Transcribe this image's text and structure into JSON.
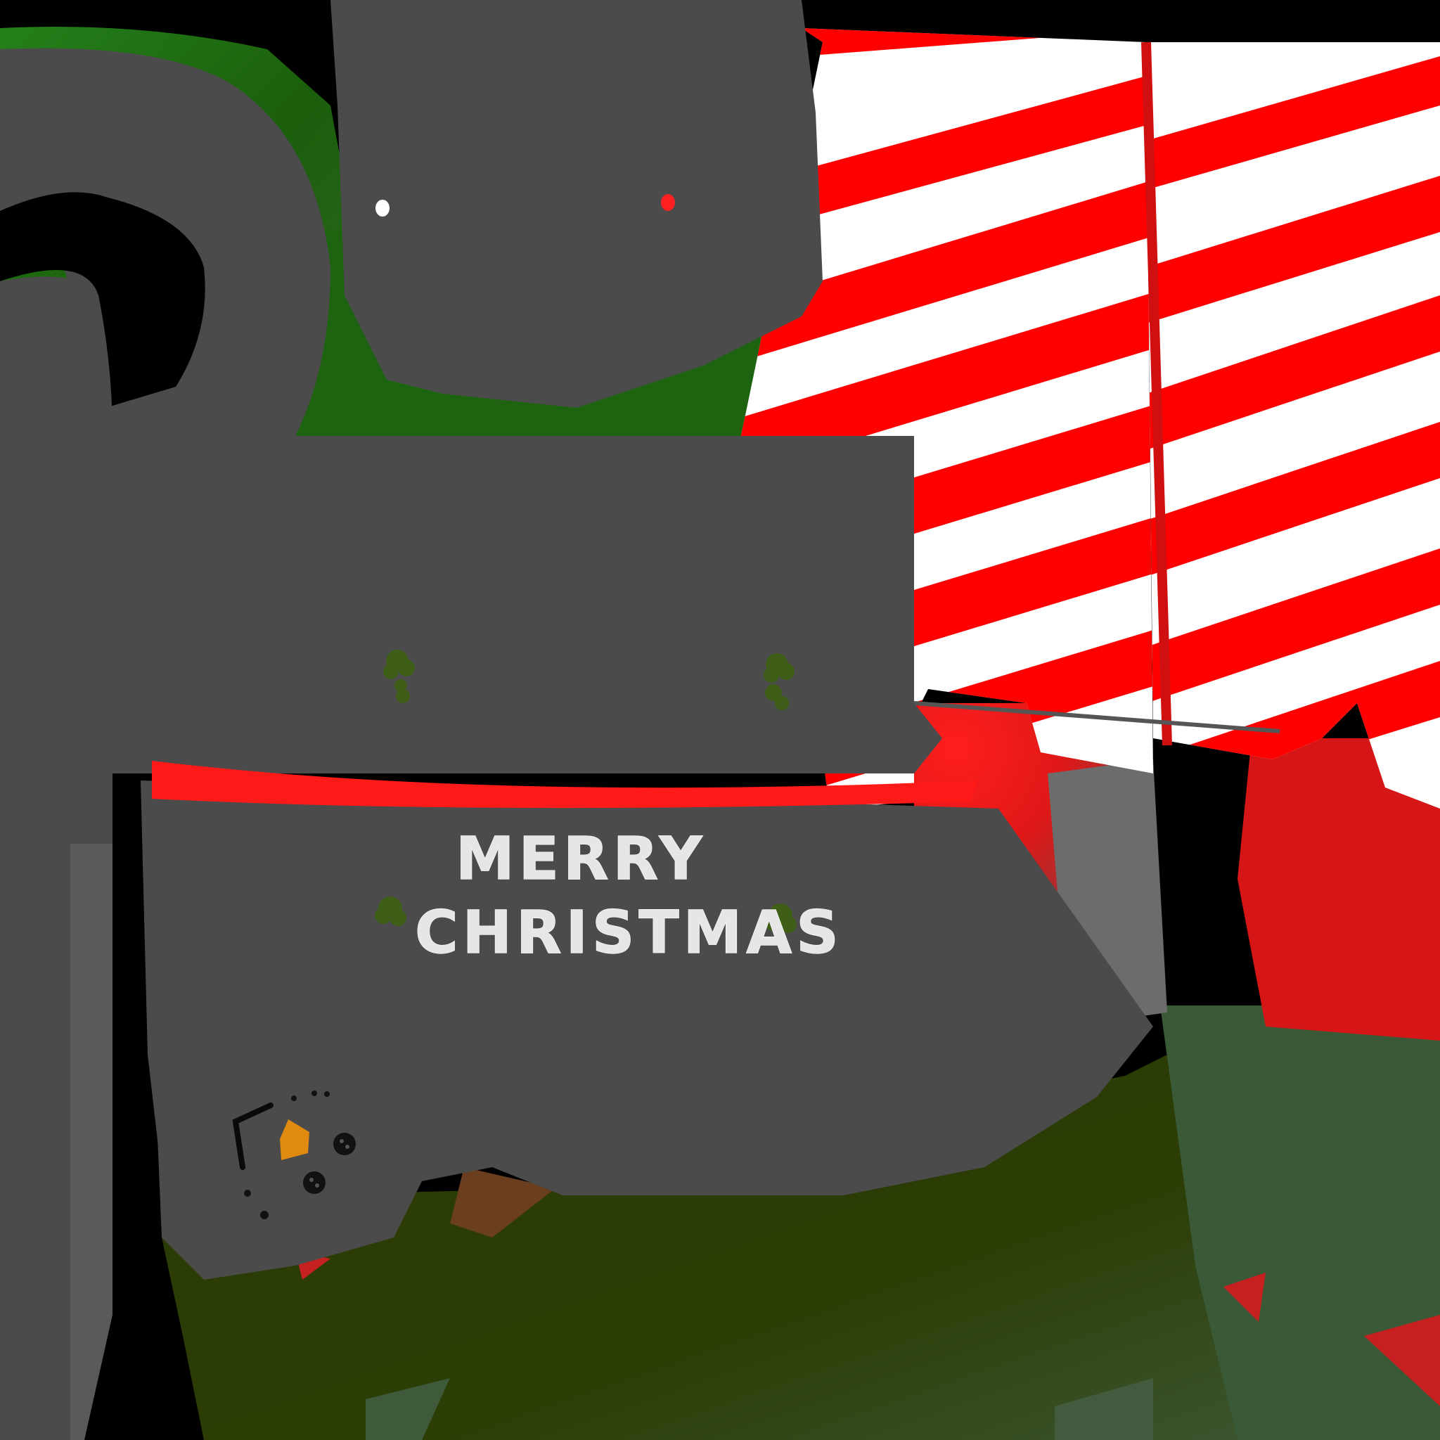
{
  "greeting": {
    "line1": "MERRY",
    "line2": "CHRISTMAS"
  },
  "colors": {
    "body": "#4b4b4b",
    "background": "#000000",
    "scarf_green": "#1f6a0e",
    "skirt_green": "#2b3c05",
    "candy_red": "#ff0000",
    "candy_white": "#ffffff",
    "ribbon": "#ff1a1a",
    "button": "#3f5f18",
    "carrot": "#e08a10",
    "pupil": "#111111",
    "eye_red": "#ff2020",
    "shadow_brown": "#6a3e1f"
  },
  "icons": {
    "snowman_face": "snowman-face-icon",
    "carrot_nose": "carrot-nose-icon",
    "coal_eye": "coal-eye-icon",
    "button": "button-icon"
  }
}
